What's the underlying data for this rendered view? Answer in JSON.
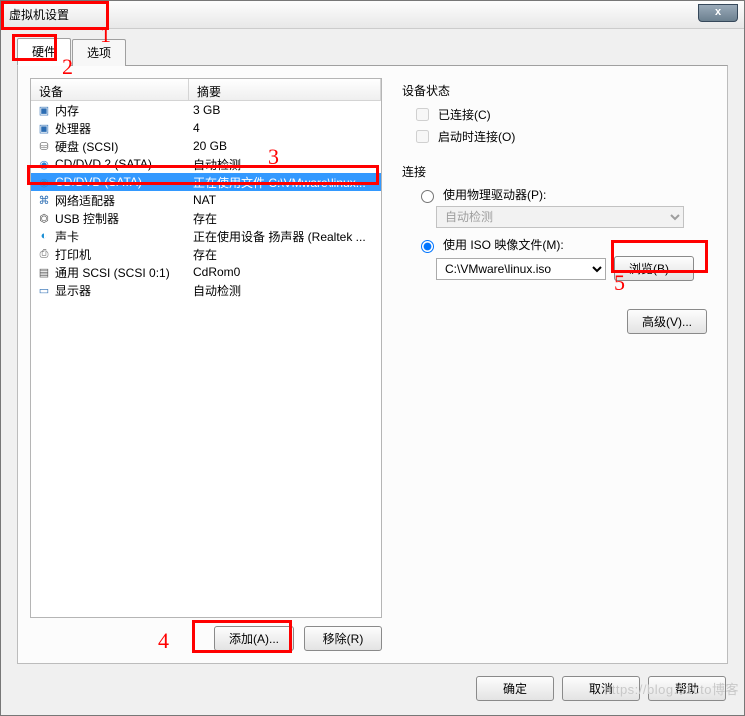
{
  "window": {
    "title": "虚拟机设置",
    "close": "x"
  },
  "tabs": {
    "hardware": "硬件",
    "options": "选项"
  },
  "table": {
    "col_device": "设备",
    "col_summary": "摘要",
    "rows": [
      {
        "icon": "▣",
        "iconcls": "ic-mem",
        "name": "内存",
        "summary": "3 GB"
      },
      {
        "icon": "▣",
        "iconcls": "ic-cpu",
        "name": "处理器",
        "summary": "4"
      },
      {
        "icon": "⛁",
        "iconcls": "ic-disk",
        "name": "硬盘 (SCSI)",
        "summary": "20 GB"
      },
      {
        "icon": "◉",
        "iconcls": "ic-cd",
        "name": "CD/DVD 2 (SATA)",
        "summary": "自动检测"
      },
      {
        "icon": "◉",
        "iconcls": "ic-cd",
        "name": "CD/DVD (SATA)",
        "summary": "正在使用文件 C:\\VMware\\linux...",
        "selected": true
      },
      {
        "icon": "⌘",
        "iconcls": "ic-net",
        "name": "网络适配器",
        "summary": "NAT"
      },
      {
        "icon": "⏣",
        "iconcls": "ic-usb",
        "name": "USB 控制器",
        "summary": "存在"
      },
      {
        "icon": "◐",
        "iconcls": "ic-snd",
        "name": "声卡",
        "summary": "正在使用设备 扬声器 (Realtek ..."
      },
      {
        "icon": "⎙",
        "iconcls": "ic-prn",
        "name": "打印机",
        "summary": "存在"
      },
      {
        "icon": "▤",
        "iconcls": "ic-scsi",
        "name": "通用 SCSI (SCSI 0:1)",
        "summary": "CdRom0"
      },
      {
        "icon": "▭",
        "iconcls": "ic-disp",
        "name": "显示器",
        "summary": "自动检测"
      }
    ]
  },
  "left_buttons": {
    "add": "添加(A)...",
    "remove": "移除(R)"
  },
  "right": {
    "status_title": "设备状态",
    "chk_connected": "已连接(C)",
    "chk_connect_at_poweron": "启动时连接(O)",
    "conn_title": "连接",
    "radio_physical": "使用物理驱动器(P):",
    "physical_value": "自动检测",
    "radio_iso": "使用 ISO 映像文件(M):",
    "iso_path": "C:\\VMware\\linux.iso",
    "browse": "浏览(B)...",
    "advanced": "高级(V)..."
  },
  "footer": {
    "ok": "确定",
    "cancel": "取消",
    "help": "帮助"
  },
  "annotations": {
    "l1": "1",
    "l2": "2",
    "l3": "3",
    "l4": "4",
    "l5": "5"
  },
  "watermark": "https://blog.51cto博客"
}
